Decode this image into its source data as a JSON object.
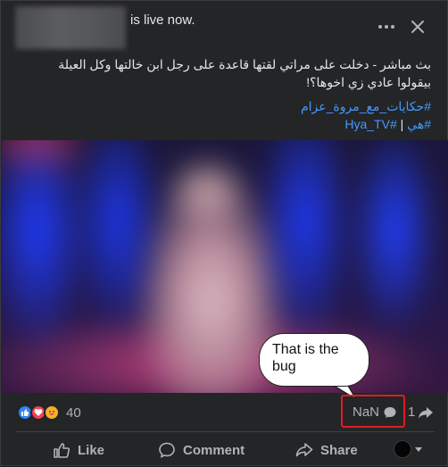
{
  "header": {
    "live_text": "is live now.",
    "more_icon": "more-dots-icon",
    "close_icon": "close-icon"
  },
  "post": {
    "text_line1": "بث مباشر - دخلت على مراتي لقتها قاعدة على رجل ابن خالتها وكل العيلة",
    "text_line2": "بيقولوا عادي زي اخوها؟!",
    "hashtag1": "#حكايات_مع_مروة_عزام",
    "hashtag2": "#هي",
    "hashtag_sep": "|",
    "hashtag3": "#Hya_TV"
  },
  "annotation": {
    "bubble_text": "That is the bug"
  },
  "stats": {
    "reaction_icons": [
      "like-icon",
      "love-icon",
      "care-icon"
    ],
    "reaction_count": "40",
    "comment_count": "NaN",
    "share_count": "1"
  },
  "actions": {
    "like_label": "Like",
    "comment_label": "Comment",
    "share_label": "Share"
  },
  "colors": {
    "background": "#242526",
    "text": "#e4e6eb",
    "secondary": "#b0b3b8",
    "link": "#4599ff",
    "highlight": "#e01b24"
  }
}
